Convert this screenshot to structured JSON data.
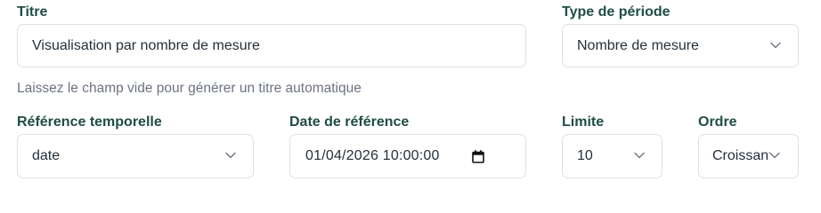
{
  "title_field": {
    "label": "Titre",
    "value": "Visualisation par nombre de mesure",
    "help": "Laissez le champ vide pour générer un titre automatique"
  },
  "period_type": {
    "label": "Type de période",
    "value": "Nombre de mesure",
    "icon": "chevron-down-icon"
  },
  "time_reference": {
    "label": "Référence temporelle",
    "value": "date",
    "icon": "chevron-down-icon"
  },
  "reference_date": {
    "label": "Date de référence",
    "value": "01/04/2026 10:00:00",
    "icon": "calendar-icon"
  },
  "limit": {
    "label": "Limite",
    "value": "10",
    "icon": "chevron-down-icon"
  },
  "order": {
    "label": "Ordre",
    "value": "Croissant",
    "icon": "chevron-down-icon"
  }
}
